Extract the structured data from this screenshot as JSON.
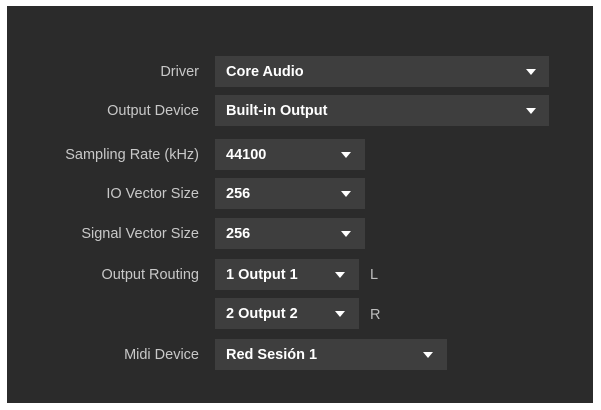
{
  "settings": {
    "driver": {
      "label": "Driver",
      "value": "Core Audio"
    },
    "output_device": {
      "label": "Output Device",
      "value": "Built-in Output"
    },
    "sampling_rate": {
      "label": "Sampling Rate (kHz)",
      "value": "44100"
    },
    "io_vector_size": {
      "label": "IO Vector Size",
      "value": "256"
    },
    "signal_vector_size": {
      "label": "Signal Vector Size",
      "value": "256"
    },
    "output_routing": {
      "label": "Output Routing",
      "channel1": {
        "value": "1 Output 1",
        "side": "L"
      },
      "channel2": {
        "value": "2 Output 2",
        "side": "R"
      }
    },
    "midi_device": {
      "label": "Midi Device",
      "value": "Red Sesión 1"
    }
  },
  "icons": {
    "dropdown": "caret-down-icon"
  },
  "colors": {
    "panel": "#2b2b2b",
    "control": "#3e3e3e",
    "label": "#c8c8c8",
    "value": "#ffffff"
  }
}
